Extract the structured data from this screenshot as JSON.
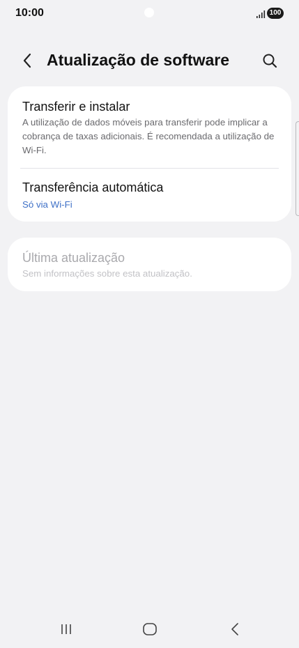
{
  "status_bar": {
    "time": "10:00",
    "battery": "100",
    "icons": [
      "camera-dot",
      "signal-icon",
      "battery-icon"
    ]
  },
  "app_bar": {
    "title": "Atualização de software",
    "back_icon": "back-arrow-icon",
    "search_icon": "search-icon"
  },
  "settings": {
    "download_install": {
      "title": "Transferir e instalar",
      "description": "A utilização de dados móveis para transferir pode implicar a cobrança de taxas adicionais. É recomendada a utilização de Wi-Fi."
    },
    "auto_download": {
      "title": "Transferência automática",
      "value": "Só via Wi-Fi"
    },
    "last_update": {
      "title": "Última atualização",
      "description": "Sem informações sobre esta atualização.",
      "enabled": false
    }
  },
  "nav_bar": {
    "icons": [
      "recents-icon",
      "home-icon",
      "back-icon"
    ]
  },
  "colors": {
    "background": "#f2f2f4",
    "card": "#ffffff",
    "accent": "#3e70c7",
    "disabled_text": "#a9a9ad"
  }
}
